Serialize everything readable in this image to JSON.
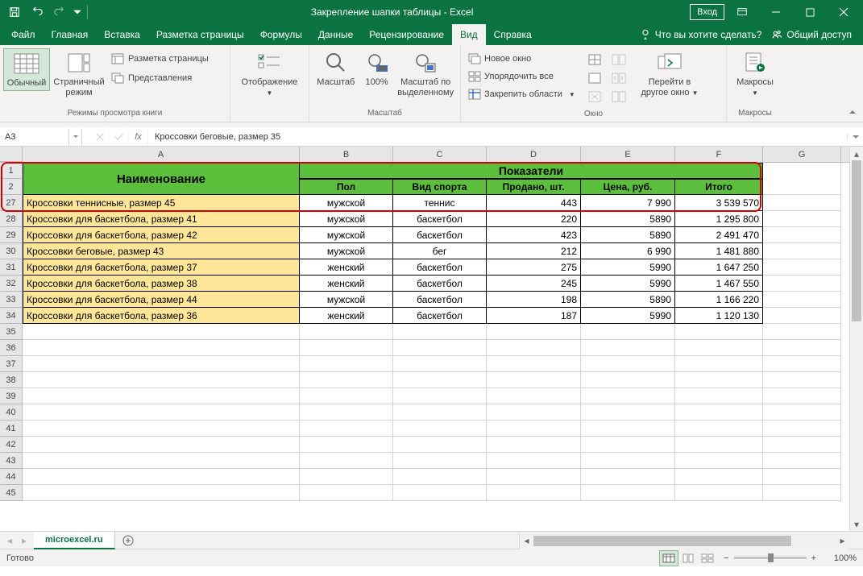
{
  "titlebar": {
    "title": "Закрепление шапки таблицы  -  Excel",
    "login": "Вход"
  },
  "menu": {
    "items": [
      "Файл",
      "Главная",
      "Вставка",
      "Разметка страницы",
      "Формулы",
      "Данные",
      "Рецензирование",
      "Вид",
      "Справка"
    ],
    "active_index": 7,
    "tellme": "Что вы хотите сделать?",
    "share": "Общий доступ"
  },
  "ribbon": {
    "group_views": {
      "normal": "Обычный",
      "page_break": "Страничный режим",
      "page_layout": "Разметка страницы",
      "custom_views": "Представления",
      "label": "Режимы просмотра книги"
    },
    "group_display": {
      "label": "Отображение"
    },
    "group_zoom": {
      "zoom": "Масштаб",
      "hundred": "100%",
      "selection": "Масштаб по выделенному",
      "label": "Масштаб"
    },
    "group_window": {
      "new_window": "Новое окно",
      "arrange": "Упорядочить все",
      "freeze": "Закрепить области",
      "switch": "Перейти в другое окно",
      "label": "Окно"
    },
    "group_macros": {
      "macros": "Макросы",
      "label": "Макросы"
    }
  },
  "formula_bar": {
    "name_box": "A3",
    "formula": "Кроссовки беговые, размер 35"
  },
  "grid": {
    "columns": [
      "A",
      "B",
      "C",
      "D",
      "E",
      "F",
      "G"
    ],
    "header_rows": [
      "1",
      "2"
    ],
    "header_name": "Наименование",
    "header_indicators": "Показатели",
    "sub_headers": [
      "Пол",
      "Вид спорта",
      "Продано, шт.",
      "Цена, руб.",
      "Итого"
    ],
    "data_rows": [
      {
        "num": "27",
        "name": "Кроссовки теннисные, размер 45",
        "gender": "мужской",
        "sport": "теннис",
        "sold": "443",
        "price": "7 990",
        "total": "3 539 570"
      },
      {
        "num": "28",
        "name": "Кроссовки для баскетбола, размер 41",
        "gender": "мужской",
        "sport": "баскетбол",
        "sold": "220",
        "price": "5890",
        "total": "1 295 800"
      },
      {
        "num": "29",
        "name": "Кроссовки для баскетбола, размер 42",
        "gender": "мужской",
        "sport": "баскетбол",
        "sold": "423",
        "price": "5890",
        "total": "2 491 470"
      },
      {
        "num": "30",
        "name": "Кроссовки беговые, размер 43",
        "gender": "мужской",
        "sport": "бег",
        "sold": "212",
        "price": "6 990",
        "total": "1 481 880"
      },
      {
        "num": "31",
        "name": "Кроссовки для баскетбола, размер 37",
        "gender": "женский",
        "sport": "баскетбол",
        "sold": "275",
        "price": "5990",
        "total": "1 647 250"
      },
      {
        "num": "32",
        "name": "Кроссовки для баскетбола, размер 38",
        "gender": "женский",
        "sport": "баскетбол",
        "sold": "245",
        "price": "5990",
        "total": "1 467 550"
      },
      {
        "num": "33",
        "name": "Кроссовки для баскетбола, размер 44",
        "gender": "мужской",
        "sport": "баскетбол",
        "sold": "198",
        "price": "5890",
        "total": "1 166 220"
      },
      {
        "num": "34",
        "name": "Кроссовки для баскетбола, размер 36",
        "gender": "женский",
        "sport": "баскетбол",
        "sold": "187",
        "price": "5990",
        "total": "1 120 130"
      }
    ],
    "empty_rows": [
      "35",
      "36",
      "37",
      "38",
      "39",
      "40",
      "41",
      "42",
      "43",
      "44",
      "45"
    ]
  },
  "sheet_tabs": {
    "active": "microexcel.ru"
  },
  "statusbar": {
    "ready": "Готово",
    "zoom": "100%"
  }
}
